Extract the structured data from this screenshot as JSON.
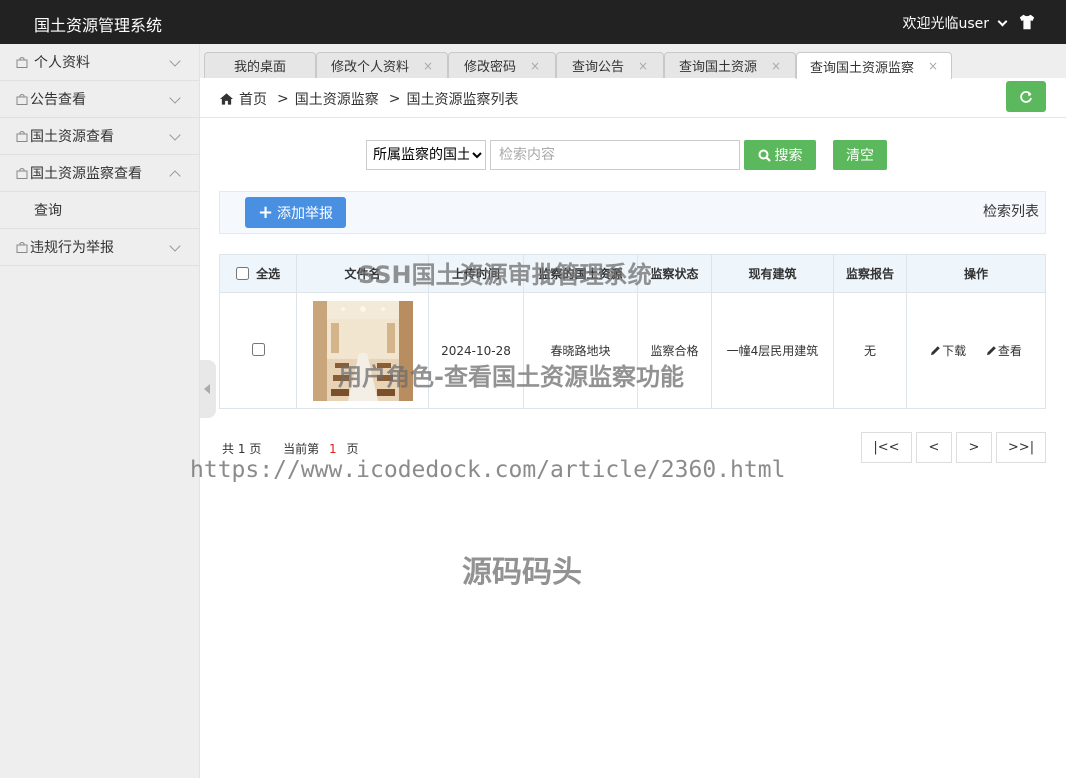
{
  "header": {
    "app_title": "国土资源管理系统",
    "welcome": "欢迎光临user",
    "shirt_icon": "shirt-icon"
  },
  "sidebar": {
    "items": [
      {
        "label": "个人资料"
      },
      {
        "label": "公告查看"
      },
      {
        "label": "国土资源查看"
      },
      {
        "label": "国土资源监察查看"
      },
      {
        "label": "违规行为举报"
      }
    ],
    "sub_items": [
      {
        "label": "查询"
      }
    ]
  },
  "tabs": [
    {
      "label": "我的桌面"
    },
    {
      "label": "修改个人资料",
      "close": "×"
    },
    {
      "label": "修改密码",
      "close": "×"
    },
    {
      "label": "查询公告",
      "close": "×"
    },
    {
      "label": "查询国土资源",
      "close": "×"
    },
    {
      "label": "查询国土资源监察",
      "close": "×"
    }
  ],
  "breadcrumb": {
    "home": "首页",
    "sep": ">",
    "level1": "国土资源监察",
    "level2": "国土资源监察列表"
  },
  "search": {
    "select_value": "所属监察的国土",
    "placeholder": "检索内容",
    "search_label": "搜索",
    "clear_label": "清空"
  },
  "toolbar": {
    "add_label": "添加举报",
    "list_label": "检索列表"
  },
  "table": {
    "headers": [
      "全选",
      "文件名",
      "上传时间",
      "监察的国土资源",
      "监察状态",
      "现有建筑",
      "监察报告",
      "操作"
    ],
    "rows": [
      {
        "upload_time": "2024-10-28",
        "land": "春晓路地块",
        "status": "监察合格",
        "building": "一幢4层民用建筑",
        "report": "无",
        "download": "下载",
        "view": "查看"
      }
    ]
  },
  "pagination": {
    "total_prefix": "共",
    "total_pages": "1",
    "page_unit": "页",
    "current_prefix": "当前第",
    "current": "1",
    "first": "|<<",
    "prev": "<",
    "next": ">",
    "last": ">>|"
  },
  "watermarks": {
    "line1": "SSH国土资源审批管理系统",
    "line2": "用户角色-查看国土资源监察功能",
    "url": "https://www.icodedock.com/article/2360.html",
    "brand": "源码码头"
  },
  "colors": {
    "header_bg": "#222222",
    "green": "#5cb85c",
    "blue": "#4a90e2",
    "red": "#d9241d"
  }
}
